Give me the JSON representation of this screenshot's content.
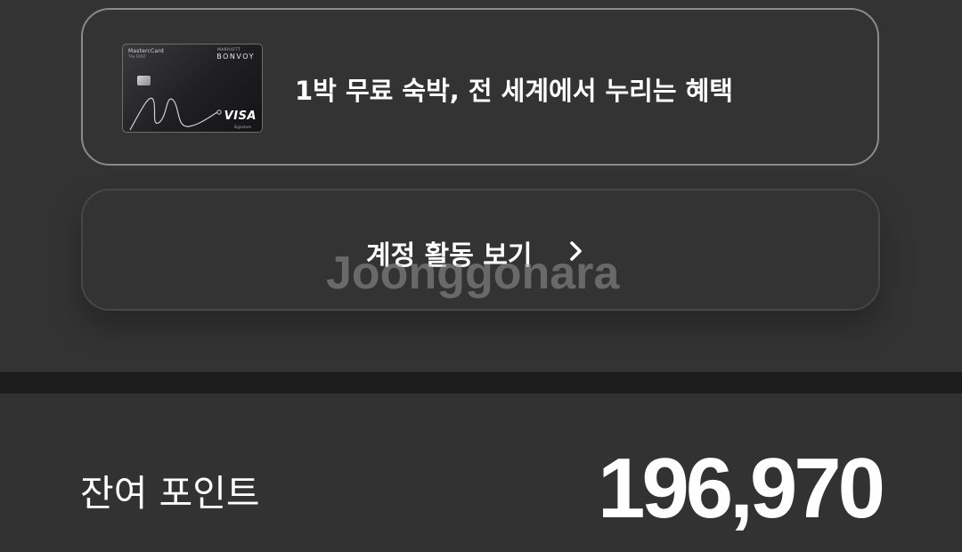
{
  "benefit_card": {
    "card_issuer": "MastercCard",
    "card_issuer_sub": "The FIRST",
    "card_brand_small": "MARRIOTT",
    "card_brand": "BONVOY",
    "card_network": "VISA",
    "card_network_sub": "Signature",
    "text": "1박 무료 숙박, 전 세계에서 누리는 혜택"
  },
  "activity_button": {
    "label": "계정 활동 보기"
  },
  "watermark": {
    "text": "Joonggonara"
  },
  "points": {
    "label": "잔여 포인트",
    "value": "196,970"
  },
  "colors": {
    "background": "#323232",
    "divider": "#1d1d1d",
    "card_border": "#8a8a8a",
    "button_border": "#474747",
    "text": "#ffffff"
  }
}
